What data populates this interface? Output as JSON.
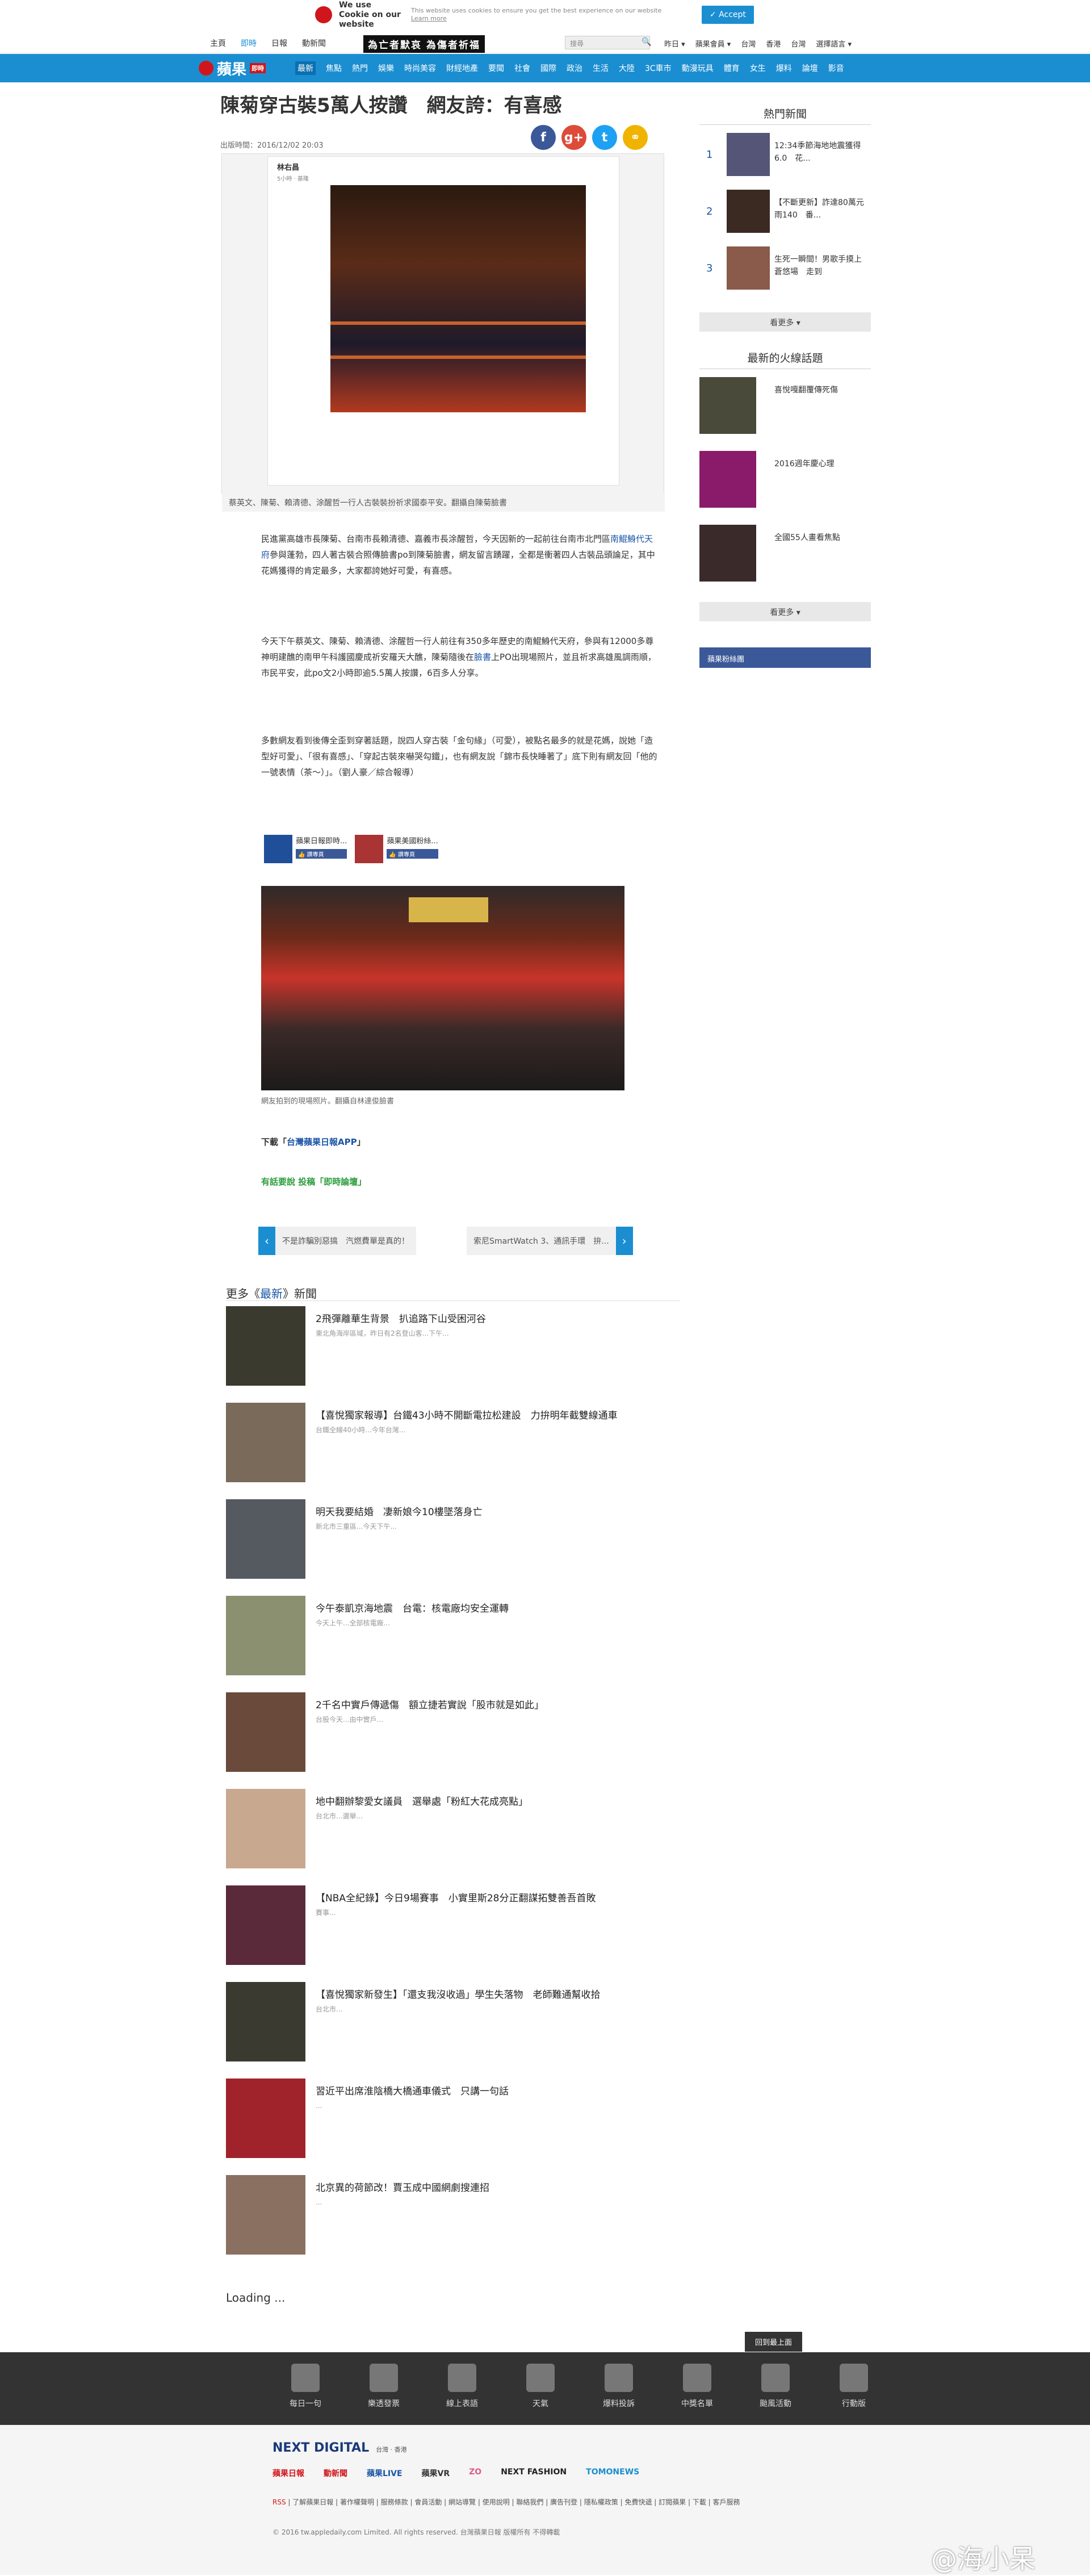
{
  "colors": {
    "accent": "#1a8ed1",
    "brand_red": "#d0161c",
    "link": "#1a55a6",
    "green": "#2a9d3a",
    "facebook": "#3b5998"
  },
  "cookie": {
    "title": "We use Cookie on our website",
    "text": "This website uses cookies to ensure you get the best experience on our website",
    "learn": "Learn more",
    "accept": "✓ Accept"
  },
  "topbar": {
    "links": [
      "主頁",
      "即時",
      "日報",
      "動新聞"
    ],
    "banner": "為亡者默哀 為傷者祈福",
    "search_placeholder": "搜尋",
    "right": [
      "昨日 ▾",
      "蘋果會員 ▾",
      "台灣",
      "香港",
      "台灣",
      "選擇語言 ▾"
    ]
  },
  "nav": {
    "logo": "蘋果",
    "logo_tag": "即時",
    "items": [
      "最新",
      "焦點",
      "熱門",
      "娛樂",
      "時尚美容",
      "財經地產",
      "要聞",
      "社會",
      "國際",
      "政治",
      "生活",
      "大陸",
      "3C車市",
      "動漫玩具",
      "體育",
      "女生",
      "爆料",
      "論壇",
      "影音"
    ]
  },
  "article": {
    "title": "陳菊穿古裝5萬人按讚　網友誇：有喜感",
    "time": "出版時間：2016/12/02 20:03",
    "fb_post_head": "林右昌",
    "fb_post_sub": "5小時 · 基隆",
    "caption": "蔡英文、陳菊、賴清德、涂醒哲一行人古裝裝扮祈求國泰平安。翻攝自陳菊臉書",
    "p1_before": "民進黨高雄市長陳菊、台南市長賴清德、嘉義市長涂醒哲，今天因新的一起前往台南市北門區",
    "p1_link": "南鯤鯓代天府",
    "p1_after": "參與蓬勃，四人著古裝合照傳臉書po到陳菊臉書，網友留言踴躍，全都是衝著四人古裝品頭論足，其中花媽獲得的肯定最多，大家都誇她好可愛，有喜感。",
    "p2_before": "今天下午蔡英文、陳菊、賴清德、涂醒哲一行人前往有350多年歷史的南鯤鯓代天府，參與有12000多尊神明建醮的南甲午科護國慶成祈安羅天大醮，陳菊隨後在",
    "p2_link": "臉書",
    "p2_after": "上PO出現場照片，並且祈求高雄風調雨順，市民平安，此po文2小時即逾5.5萬人按讚，6百多人分享。",
    "p3": "多數網友看到後傳全歪到穿著話題，說四人穿古裝「金句緣」（可愛），被點名最多的就是花媽，說她「造型好可愛」、「很有喜感」、「穿起古裝來嚇哭勾鐵」，也有網友說「錦市長快睡著了」底下則有網友回「他的一號表情（茶～）」。（劉人豪／綜合報導）",
    "fb_cards": [
      {
        "name": "蘋果日報即時...",
        "like": "👍 讚專頁"
      },
      {
        "name": "蘋果美國粉絲...",
        "like": "👍 讚專頁"
      }
    ],
    "photo2_caption": "網友拍到的現場照片。翻攝自林達俊臉書",
    "download_prefix": "下載「",
    "download_link": "台灣蘋果日報APP",
    "download_suffix": "」",
    "poll": "有話要說 投稿「即時論壇」",
    "prev": "不是詐騙別惡搞　汽燃費單是真的！",
    "next": "索尼SmartWatch 3、通訊手環　拚..."
  },
  "more": {
    "prefix": "更多《",
    "section": "最新",
    "suffix": "》新聞",
    "items": [
      {
        "title": "2飛彈離華生背景　扒追路下山受困河谷",
        "desc": "東北角海岸區域，昨日有2名登山客...下午..."
      },
      {
        "title": "【喜悅獨家報導】台鐵43小時不開斷電拉松建設　力拚明年截雙線通車",
        "desc": "台鐵全線40小時...今年台灣..."
      },
      {
        "title": "明天我要結婚　凄新娘今10樓墜落身亡",
        "desc": "新北市三重區...今天下午..."
      },
      {
        "title": "今午泰凱京海地震　台電：核電廠均安全運轉",
        "desc": "今天上午...全部核電廠..."
      },
      {
        "title": "2千名中實戶傳遞傷　額立捷若實說「股市就是如此」",
        "desc": "台股今天...由中實戶..."
      },
      {
        "title": "地中翻辦黎愛女議員　選舉處「粉紅大花成亮點」",
        "desc": "台北市...選舉..."
      },
      {
        "title": "【NBA全紀錄】今日9場賽事　小實里斯28分正翻謀拓雙善吾首敗",
        "desc": "賽事..."
      },
      {
        "title": "【喜悅獨家新發生】「還支我沒收過」學生失落物　老師難通幫收拾",
        "desc": "台北市..."
      },
      {
        "title": "習近平出席淮陰橋大橋通車儀式　只講一句話",
        "desc": "..."
      },
      {
        "title": "北京異的荷節改！賈玉成中國網劇搜連招",
        "desc": "..."
      }
    ],
    "loading": "Loading ...",
    "gotop": "回到最上面"
  },
  "sidebar": {
    "hot_title": "熱門新聞",
    "hot": [
      {
        "num": "1",
        "text": "12:34季節海地地震獲得6.0　花..."
      },
      {
        "num": "2",
        "text": "【不斷更新】詐達80萬元雨140　番..."
      },
      {
        "num": "3",
        "text": "生死一瞬間！男歌手摸上蒼悠場　走到"
      }
    ],
    "more": "看更多 ▾",
    "fire_title": "最新的火線話題",
    "fire": [
      {
        "text": "喜悅嘎翻覆傳死傷"
      },
      {
        "text": "2016週年慶心理"
      },
      {
        "text": "全國55人畫看焦點"
      }
    ],
    "more2": "看更多 ▾",
    "fbpage": "蘋果粉絲團"
  },
  "footer": {
    "icons": [
      "每日一句",
      "樂透發票",
      "線上表語",
      "天氣",
      "爆料投訴",
      "中獎名單",
      "颱風活動",
      "行動版"
    ],
    "nd": "NEXT DIGITAL",
    "nd_small": "台灣 · 香港",
    "brands": [
      "蘋果日報",
      "動新聞",
      "蘋果LIVE",
      "蘋果VR",
      "ZO",
      "NEXT FASHION",
      "TOMONEWS"
    ],
    "links": [
      "RSS",
      "了解蘋果日報",
      "著作權聲明",
      "服務條款",
      "會員活動",
      "網站導覽",
      "使用說明",
      "聯絡我們",
      "廣告刊登",
      "隱私權政策",
      "免費快遞",
      "訂閱蘋果",
      "下載",
      "客戶服務"
    ],
    "copy": "© 2016 tw.appledaily.com Limited. All rights reserved. 台灣蘋果日報 版權所有 不得轉載"
  },
  "watermark": "@海小呆"
}
